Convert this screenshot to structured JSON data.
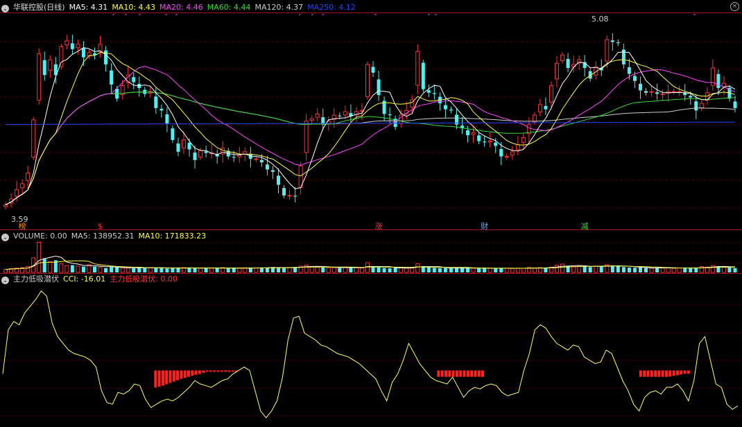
{
  "header_main": {
    "title": "华联控股(日线)",
    "ma": [
      {
        "label": "MA5: 4.31",
        "color": "#ffffff"
      },
      {
        "label": "MA10: 4.43",
        "color": "#ffff44"
      },
      {
        "label": "MA20: 4.46",
        "color": "#ff44ff"
      },
      {
        "label": "MA60: 4.44",
        "color": "#33dd33"
      },
      {
        "label": "MA120: 4.37",
        "color": "#cccccc"
      },
      {
        "label": "MA250: 4.12",
        "color": "#2244ff"
      }
    ]
  },
  "header_vol": {
    "items": [
      {
        "label": "VOLUME: 0.00",
        "color": "#cccccc"
      },
      {
        "label": "MA5: 138952.31",
        "color": "#cccccc"
      },
      {
        "label": "MA10: 171833.23",
        "color": "#ffff44"
      }
    ]
  },
  "header_ind": {
    "items": [
      {
        "label": "主力低吸潜伏",
        "color": "#cccccc"
      },
      {
        "label": "CCI: -16.01",
        "color": "#ffff44"
      },
      {
        "label": "主力低吸潜伏: 0.00",
        "color": "#ff3333"
      }
    ]
  },
  "annotations": {
    "high_label": "5.08",
    "low_label": "3.59",
    "event_marks": [
      {
        "text": "榜",
        "index": 3,
        "color": "#ff8800"
      },
      {
        "text": "$",
        "index": 17,
        "color": "#ff3333"
      },
      {
        "text": "涨",
        "index": 67,
        "color": "#ff3333"
      },
      {
        "text": "财",
        "index": 86,
        "color": "#66aaff"
      },
      {
        "text": "减",
        "index": 104,
        "color": "#33dd33"
      }
    ]
  },
  "colors": {
    "up": "#ff3333",
    "down": "#55eeee",
    "grid": "#661111",
    "ma250": "#2244ff",
    "cci": "#ffff66",
    "signal": "#ff2020",
    "vol_ma5": "#ffffff",
    "vol_ma10": "#ffff44"
  },
  "chart_data": {
    "type": "candlestick",
    "price_ylim": [
      3.5,
      5.25
    ],
    "closes": [
      3.62,
      3.67,
      3.75,
      3.8,
      3.89,
      4.34,
      4.9,
      4.72,
      4.85,
      4.72,
      4.96,
      5.01,
      4.94,
      4.98,
      4.87,
      4.91,
      4.89,
      4.98,
      4.81,
      4.64,
      4.52,
      4.63,
      4.72,
      4.66,
      4.61,
      4.56,
      4.58,
      4.44,
      4.42,
      4.31,
      4.17,
      4.07,
      4.17,
      4.09,
      4.0,
      4.08,
      4.06,
      4.06,
      4.03,
      4.1,
      4.03,
      4.02,
      4.04,
      4.07,
      4.01,
      4.01,
      3.98,
      3.92,
      3.9,
      3.79,
      3.7,
      3.7,
      3.69,
      3.95,
      4.33,
      4.35,
      4.39,
      4.3,
      4.33,
      4.38,
      4.37,
      4.41,
      4.37,
      4.41,
      4.42,
      4.81,
      4.74,
      4.55,
      4.39,
      4.38,
      4.28,
      4.38,
      4.42,
      4.51,
      4.92,
      4.6,
      4.57,
      4.56,
      4.48,
      4.43,
      4.42,
      4.3,
      4.27,
      4.21,
      4.23,
      4.16,
      4.15,
      4.16,
      4.12,
      4.03,
      4.03,
      4.07,
      4.13,
      4.19,
      4.3,
      4.38,
      4.47,
      4.43,
      4.63,
      4.82,
      4.89,
      4.78,
      4.81,
      4.85,
      4.78,
      4.69,
      4.79,
      4.76,
      5.02,
      5.0,
      4.99,
      4.81,
      4.73,
      4.67,
      4.59,
      4.57,
      4.58,
      4.56,
      4.56,
      4.58,
      4.58,
      4.58,
      4.55,
      4.53,
      4.42,
      4.48,
      4.57,
      4.78,
      4.61,
      4.65,
      4.52,
      4.44
    ],
    "volumes": [
      60000,
      80000,
      90000,
      100000,
      120000,
      300000,
      620000,
      280000,
      220000,
      250000,
      180000,
      140000,
      150000,
      130000,
      120000,
      160000,
      120000,
      110000,
      90000,
      110000,
      100000,
      95000,
      90000,
      85000,
      110000,
      90000,
      100000,
      95000,
      90000,
      80000,
      95000,
      85000,
      100000,
      90000,
      95000,
      85000,
      90000,
      95000,
      85000,
      100000,
      80000,
      90000,
      85000,
      95000,
      100000,
      90000,
      100000,
      95000,
      110000,
      100000,
      90000,
      100000,
      110000,
      130000,
      150000,
      120000,
      110000,
      100000,
      95000,
      100000,
      90000,
      110000,
      95000,
      100000,
      90000,
      200000,
      120000,
      100000,
      90000,
      85000,
      95000,
      90000,
      85000,
      100000,
      180000,
      130000,
      100000,
      90000,
      85000,
      90000,
      85000,
      90000,
      95000,
      85000,
      90000,
      80000,
      90000,
      85000,
      80000,
      90000,
      85000,
      80000,
      90000,
      85000,
      100000,
      90000,
      100000,
      95000,
      110000,
      150000,
      170000,
      130000,
      120000,
      140000,
      120000,
      110000,
      130000,
      120000,
      160000,
      140000,
      130000,
      110000,
      100000,
      95000,
      100000,
      90000,
      85000,
      95000,
      90000,
      100000,
      85000,
      90000,
      95000,
      85000,
      100000,
      120000,
      110000,
      140000,
      130000,
      110000,
      100000,
      90000
    ],
    "vol_ylim": [
      0,
      640000
    ],
    "cci": [
      -70,
      60,
      85,
      75,
      110,
      130,
      150,
      175,
      160,
      80,
      40,
      20,
      0,
      -10,
      -15,
      -20,
      -30,
      -50,
      -120,
      -155,
      -160,
      -125,
      -130,
      -120,
      -100,
      -105,
      -145,
      -170,
      -160,
      -150,
      -145,
      -150,
      -140,
      -125,
      -110,
      -90,
      -100,
      -105,
      -110,
      -100,
      -90,
      -85,
      -70,
      -60,
      -50,
      -60,
      -120,
      -180,
      -200,
      -180,
      -150,
      -80,
      30,
      95,
      100,
      50,
      40,
      30,
      15,
      10,
      0,
      -10,
      -15,
      -20,
      -30,
      -40,
      -55,
      -70,
      -85,
      -120,
      -150,
      -95,
      -70,
      -30,
      20,
      -10,
      -40,
      -60,
      -80,
      -90,
      -95,
      -100,
      -80,
      -110,
      -140,
      -120,
      -110,
      -115,
      -105,
      -100,
      -105,
      -125,
      -135,
      -130,
      -125,
      -60,
      -10,
      60,
      75,
      65,
      40,
      20,
      10,
      0,
      15,
      10,
      -20,
      -30,
      -40,
      -35,
      0,
      -10,
      -50,
      -90,
      -120,
      -160,
      -180,
      -140,
      -125,
      -120,
      -130,
      -110,
      -110,
      -100,
      -120,
      -150,
      -90,
      20,
      40,
      -30,
      -100,
      -110,
      -160,
      -175,
      -165
    ],
    "cci_ylim": [
      -215,
      195
    ],
    "signals": [
      {
        "start": 41,
        "values": [
          -110,
          -108,
          -105,
          -101,
          -97,
          -93,
          -89,
          -85,
          -82,
          -79,
          -76,
          -73,
          -70,
          -67,
          -64,
          -63,
          -62,
          -62,
          -63,
          -63,
          -63,
          -63,
          -63
        ]
      },
      {
        "start": 118,
        "values": [
          -79,
          -79,
          -79,
          -79,
          -79,
          -79,
          -79,
          -79,
          -79,
          -79,
          -79,
          -79,
          -79
        ]
      },
      {
        "start": 173,
        "values": [
          -79,
          -79,
          -79,
          -79,
          -79,
          -79,
          -79,
          -79,
          -78,
          -76,
          -74,
          -72,
          -70,
          -70
        ]
      }
    ]
  }
}
